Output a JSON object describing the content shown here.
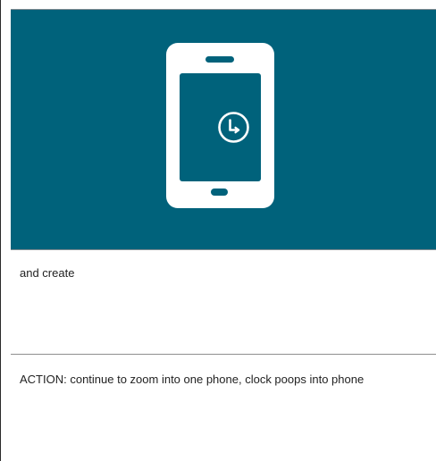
{
  "colors": {
    "hero_background": "#00627b",
    "phone_body": "#ffffff",
    "phone_screen": "#00627b"
  },
  "hero": {
    "icon": "smartphone-with-clock-icon"
  },
  "rows": [
    {
      "text": "and create"
    },
    {
      "text": "ACTION: continue to zoom into one phone, clock poops into phone"
    }
  ]
}
